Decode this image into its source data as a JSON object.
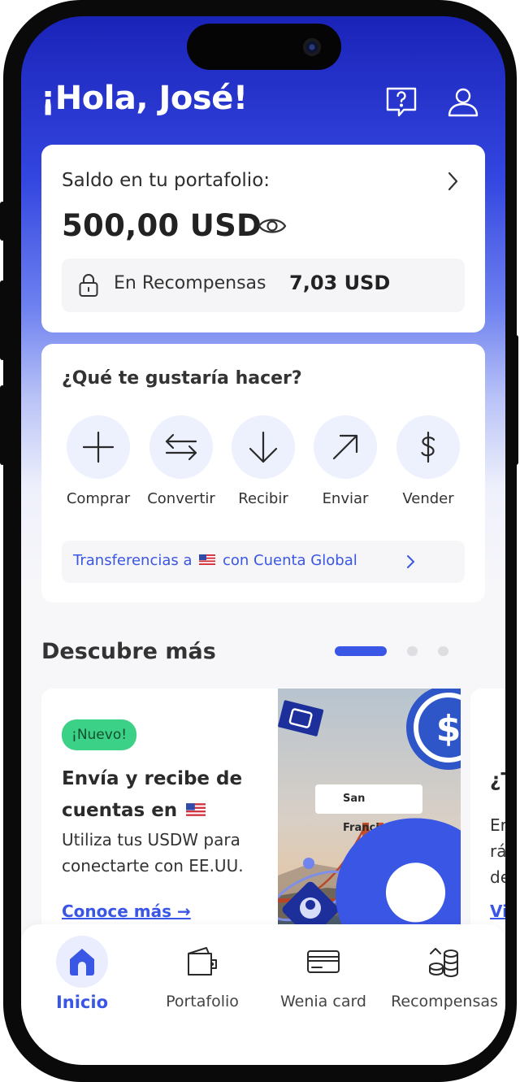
{
  "header": {
    "greeting": "¡Hola, José!",
    "help_icon": "help-question-icon",
    "profile_icon": "user-profile-icon"
  },
  "balance": {
    "label": "Saldo en tu portafolio:",
    "amount": "500,00 USD",
    "rewards_label": "En Recompensas",
    "rewards_value": "7,03 USD"
  },
  "actions": {
    "title": "¿Qué te gustaría hacer?",
    "items": [
      {
        "label": "Comprar",
        "icon": "plus-icon"
      },
      {
        "label": "Convertir",
        "icon": "swap-arrows-icon"
      },
      {
        "label": "Recibir",
        "icon": "arrow-down-icon"
      },
      {
        "label": "Enviar",
        "icon": "arrow-up-right-icon"
      },
      {
        "label": "Vender",
        "icon": "dollar-icon"
      }
    ],
    "transfer_prefix": "Transferencias a",
    "transfer_suffix": "con Cuenta Global"
  },
  "discover": {
    "title": "Descubre más",
    "page_indicator": {
      "current": 1,
      "total": 3
    },
    "promo": {
      "badge": "¡Nuevo!",
      "title": "Envía y recibe de cuentas en",
      "description": "Utiliza tus USDW para conectarte con EE.UU.",
      "link": "Conoce más →",
      "image_location": "San Francisco"
    },
    "next_promo": {
      "title_fragment": "¿T",
      "lines": [
        "Er",
        "rá",
        "de"
      ],
      "link_fragment": "Vi"
    }
  },
  "nav": {
    "items": [
      {
        "label": "Inicio",
        "icon": "home-icon",
        "active": true
      },
      {
        "label": "Portafolio",
        "icon": "wallet-icon",
        "active": false
      },
      {
        "label": "Wenia card",
        "icon": "credit-card-icon",
        "active": false
      },
      {
        "label": "Recompensas",
        "icon": "coins-icon",
        "active": false
      }
    ]
  },
  "colors": {
    "accent": "#3a56e4",
    "header_gradient_top": "#1a23b8",
    "badge_green": "#3bd186"
  }
}
